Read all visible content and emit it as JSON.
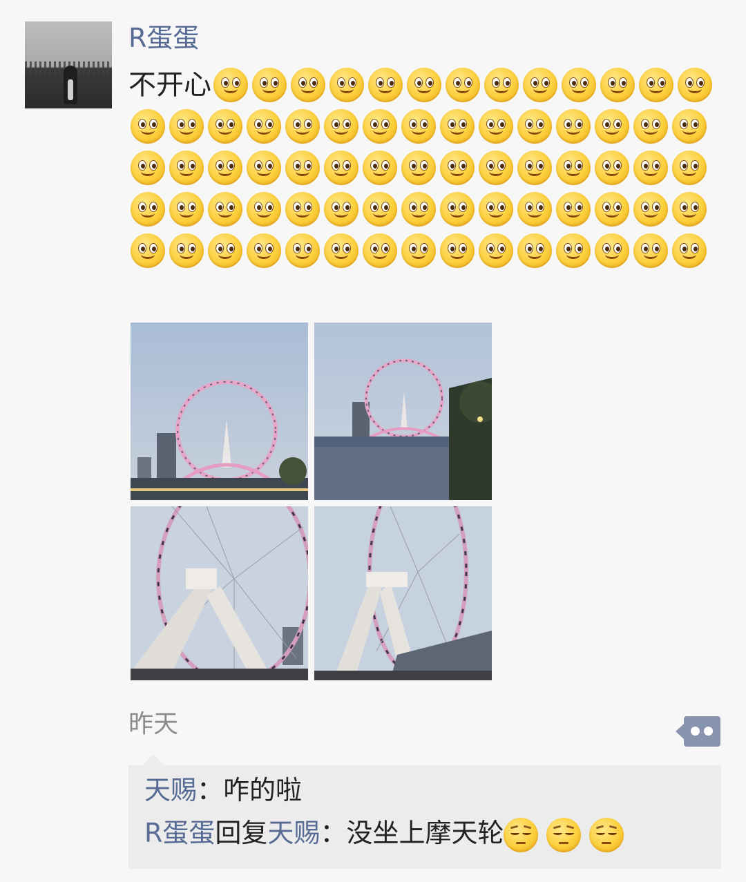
{
  "post": {
    "author": "R蛋蛋",
    "text": "不开心",
    "smile_icon": "smile-emoji-icon",
    "smile_count": 73,
    "time": "昨天"
  },
  "photos": [
    {
      "name": "ferris-wheel-photo-1"
    },
    {
      "name": "ferris-wheel-photo-2"
    },
    {
      "name": "ferris-wheel-photo-3"
    },
    {
      "name": "ferris-wheel-photo-4"
    }
  ],
  "comments": [
    {
      "author": "天赐",
      "separator": "：",
      "text": "咋的啦"
    },
    {
      "author": "R蛋蛋",
      "reply_word": "回复",
      "reply_to": "天赐",
      "separator": "：",
      "text": "没坐上摩天轮",
      "sad_icon": "sad-emoji-icon",
      "sad_count": 3
    }
  ],
  "colors": {
    "link": "#576b95",
    "more_button": "#8893ad",
    "comment_bg": "#ececec"
  }
}
